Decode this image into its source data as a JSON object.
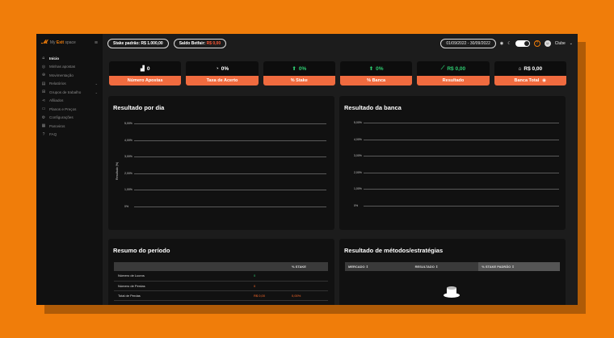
{
  "brand": {
    "logo": "𝓜",
    "name_prefix": "My ",
    "name_bold": "Exit",
    "name_suffix": " space"
  },
  "sidebar": {
    "items": [
      {
        "label": "Início",
        "icon": "home-icon",
        "glyph": "⌂",
        "active": true,
        "chev": ""
      },
      {
        "label": "Minhas apostas",
        "icon": "bets-icon",
        "glyph": "◎",
        "active": false,
        "chev": ""
      },
      {
        "label": "Movimentação",
        "icon": "movement-icon",
        "glyph": "⊕",
        "active": false,
        "chev": ""
      },
      {
        "label": "Relatórios",
        "icon": "reports-icon",
        "glyph": "▤",
        "active": false,
        "chev": "⌄"
      },
      {
        "label": "Grupos de trabalho",
        "icon": "groups-icon",
        "glyph": "⊞",
        "active": false,
        "chev": "⌄"
      },
      {
        "label": "Afiliados",
        "icon": "share-icon",
        "glyph": "⋖",
        "active": false,
        "chev": ""
      },
      {
        "label": "Planos e Preços",
        "icon": "plans-icon",
        "glyph": "▭",
        "active": false,
        "chev": ""
      },
      {
        "label": "Configurações",
        "icon": "gear-icon",
        "glyph": "⚙",
        "active": false,
        "chev": ""
      },
      {
        "label": "Parceiros",
        "icon": "partners-icon",
        "glyph": "▦",
        "active": false,
        "chev": ""
      },
      {
        "label": "FAQ",
        "icon": "faq-icon",
        "glyph": "?",
        "active": false,
        "chev": ""
      }
    ]
  },
  "topbar": {
    "stake_label": "Stake padrão: R$ 1.000,00",
    "saldo_label": "Saldo Betfair:",
    "saldo_value": "R$ 0,00",
    "date_range": "01/09/2022 - 30/09/2022",
    "user": "Clube"
  },
  "stats": [
    {
      "value": "0",
      "icon": "bar-chart-icon",
      "glyph": "▟",
      "label": "Número Apostas",
      "green": false,
      "label_icon": ""
    },
    {
      "value": "0%",
      "icon": "gauge-icon",
      "glyph": "◔",
      "label": "Taxa de Acerto",
      "green": false,
      "label_icon": ""
    },
    {
      "value": "0%",
      "icon": "arrow-up-icon",
      "glyph": "⬆",
      "label": "% Stake",
      "green": true,
      "label_icon": ""
    },
    {
      "value": "0%",
      "icon": "arrow-up-icon",
      "glyph": "⬆",
      "label": "% Banca",
      "green": true,
      "label_icon": ""
    },
    {
      "value": "R$ 0,00",
      "icon": "line-chart-icon",
      "glyph": "⟋",
      "label": "Resultado",
      "green": true,
      "label_icon": ""
    },
    {
      "value": "R$ 0,00",
      "icon": "bank-icon",
      "glyph": "⌂",
      "label": "Banca Total",
      "green": false,
      "label_icon": "◉"
    }
  ],
  "chart1": {
    "title": "Resultado por dia",
    "ylabel": "Resultado (%)",
    "ticks": [
      "5,00%",
      "4,00%",
      "3,00%",
      "2,00%",
      "1,00%",
      "0%"
    ]
  },
  "chart2": {
    "title": "Resultado da banca",
    "ticks": [
      "5,00%",
      "4,00%",
      "3,00%",
      "2,00%",
      "1,00%",
      "0%"
    ]
  },
  "resumo": {
    "title": "Resumo do período",
    "col_stake": "% STAKE",
    "rows": [
      {
        "label": "Número de Lucros",
        "v1": "0",
        "v2": "",
        "v1_class": "green"
      },
      {
        "label": "Número de Perdas",
        "v1": "0",
        "v2": "",
        "v1_class": "orange"
      },
      {
        "label": "Total de Perdas",
        "v1": "R$ 0,00",
        "v2": "0,00%",
        "v1_class": "orange"
      }
    ]
  },
  "metodos": {
    "title": "Resultado de métodos/estratégias",
    "cols": [
      "MERCADO ⇕",
      "RESULTADO ⇕",
      "% STAKE PADRÃO ⇕"
    ]
  }
}
